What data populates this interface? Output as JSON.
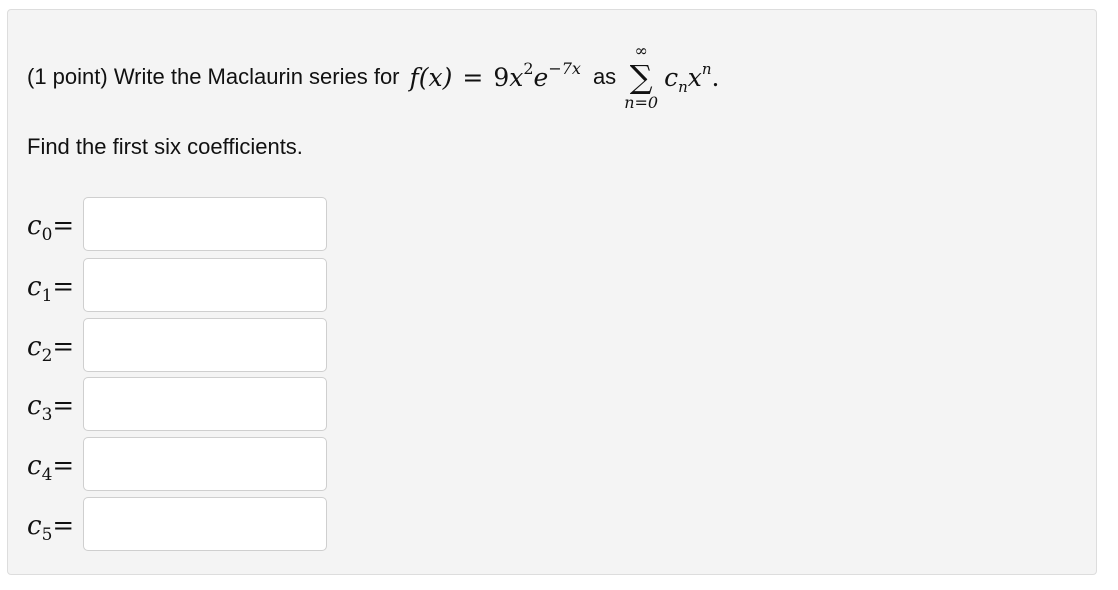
{
  "problem": {
    "point_label": "(1 point) Write the Maclaurin series for",
    "function_lhs": "f(x)",
    "equals": "=",
    "coefficient": "9",
    "x_var": "x",
    "x_power": "2",
    "e_base": "e",
    "e_power": "−7x",
    "as_word": "as",
    "sum_upper": "∞",
    "sum_symbol": "∑",
    "sum_lower": "n=0",
    "term_c": "c",
    "term_sub": "n",
    "term_x": "x",
    "term_power": "n",
    "term_end": "."
  },
  "instruction": "Find the first six coefficients.",
  "coefficients": [
    {
      "var": "c",
      "index": "0",
      "equals": "=",
      "value": ""
    },
    {
      "var": "c",
      "index": "1",
      "equals": "=",
      "value": ""
    },
    {
      "var": "c",
      "index": "2",
      "equals": "=",
      "value": ""
    },
    {
      "var": "c",
      "index": "3",
      "equals": "=",
      "value": ""
    },
    {
      "var": "c",
      "index": "4",
      "equals": "=",
      "value": ""
    },
    {
      "var": "c",
      "index": "5",
      "equals": "=",
      "value": ""
    }
  ]
}
